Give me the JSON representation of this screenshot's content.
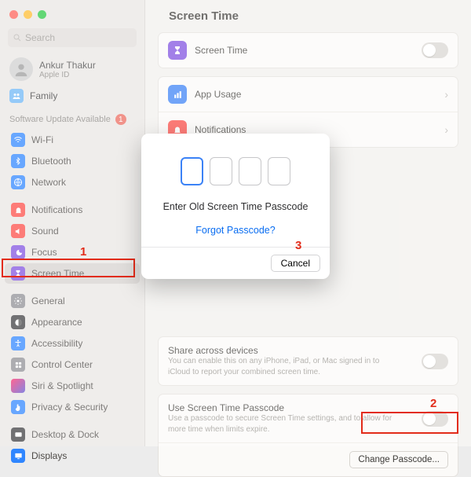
{
  "sidebar": {
    "search_placeholder": "Search",
    "user_name": "Ankur Thakur",
    "user_sub": "Apple ID",
    "family_label": "Family",
    "update_label": "Software Update Available",
    "update_badge": "1",
    "items": [
      {
        "label": "Wi-Fi"
      },
      {
        "label": "Bluetooth"
      },
      {
        "label": "Network"
      },
      {
        "label": "Notifications"
      },
      {
        "label": "Sound"
      },
      {
        "label": "Focus"
      },
      {
        "label": "Screen Time"
      },
      {
        "label": "General"
      },
      {
        "label": "Appearance"
      },
      {
        "label": "Accessibility"
      },
      {
        "label": "Control Center"
      },
      {
        "label": "Siri & Spotlight"
      },
      {
        "label": "Privacy & Security"
      },
      {
        "label": "Desktop & Dock"
      },
      {
        "label": "Displays"
      }
    ]
  },
  "main": {
    "title": "Screen Time",
    "screen_time_label": "Screen Time",
    "app_usage_label": "App Usage",
    "notifications_label": "Notifications",
    "share_title": "Share across devices",
    "share_sub": "You can enable this on any iPhone, iPad, or Mac signed in to iCloud to report your combined screen time.",
    "passcode_title": "Use Screen Time Passcode",
    "passcode_sub": "Use a passcode to secure Screen Time settings, and to allow for more time when limits expire.",
    "change_btn": "Change Passcode..."
  },
  "modal": {
    "message": "Enter Old Screen Time Passcode",
    "forgot": "Forgot Passcode?",
    "cancel": "Cancel"
  },
  "annotations": {
    "n1": "1",
    "n2": "2",
    "n3": "3"
  }
}
